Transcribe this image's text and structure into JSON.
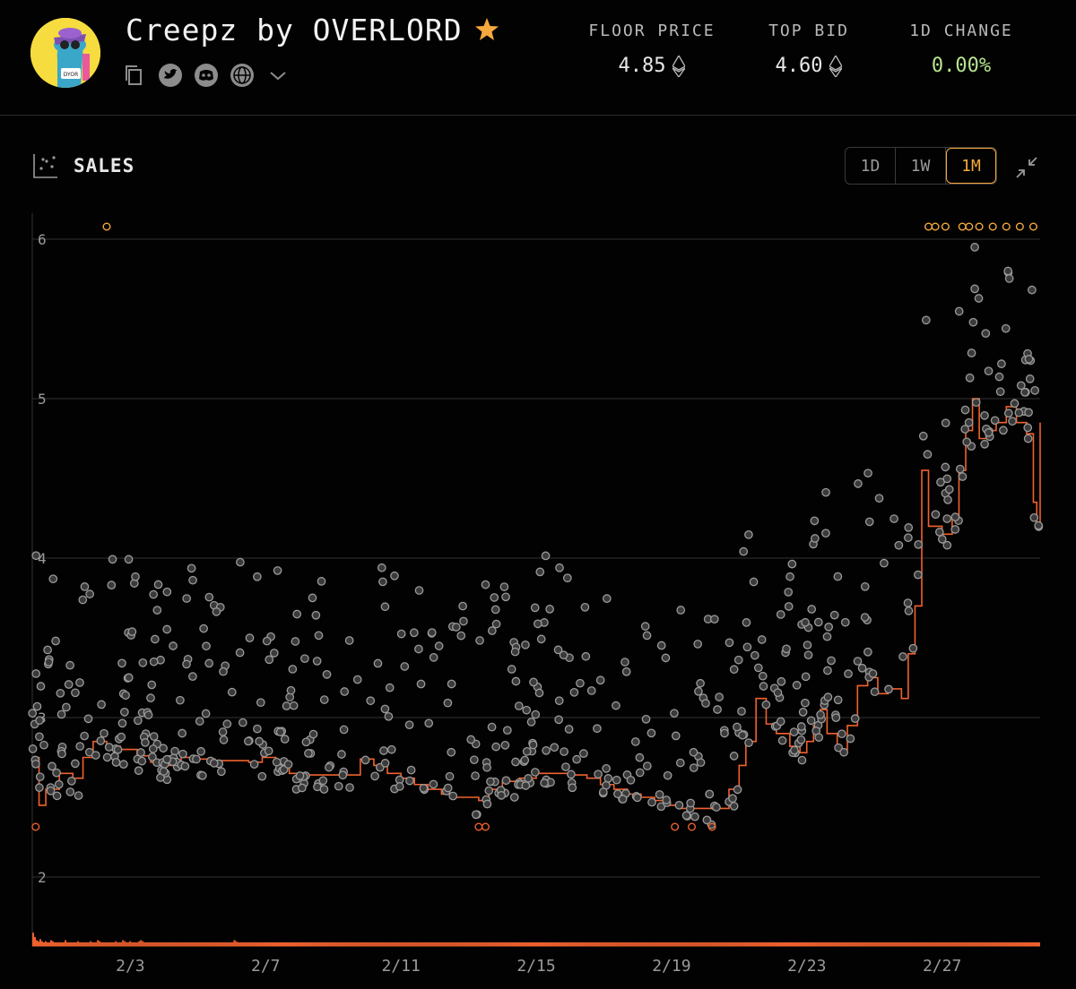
{
  "collection": {
    "name": "Creepz by OVERLORD",
    "avatar_text": "DYOR",
    "icons": [
      "copy-icon",
      "twitter-icon",
      "discord-icon",
      "globe-icon",
      "chevron-down-icon"
    ]
  },
  "stats": [
    {
      "label": "FLOOR PRICE",
      "value": "4.85",
      "unit_icon": "eth-icon"
    },
    {
      "label": "TOP BID",
      "value": "4.60",
      "unit_icon": "eth-icon"
    },
    {
      "label": "1D CHANGE",
      "value": "0.00%",
      "color": "#b7e58e"
    }
  ],
  "sales": {
    "label": "SALES",
    "ranges": [
      "1D",
      "1W",
      "1M"
    ],
    "active_range": "1M"
  },
  "colors": {
    "accent": "#f5a93e",
    "floor_line": "#f0622e",
    "sale_dot": "#9a9a9a",
    "background": "#020202"
  },
  "chart_data": {
    "type": "scatter",
    "title": "",
    "xlabel": "",
    "ylabel": "",
    "y_ticks": [
      2,
      3,
      4,
      5,
      6
    ],
    "ylim": [
      1.6,
      6.2
    ],
    "x_ticks": [
      "2/3",
      "2/7",
      "2/11",
      "2/15",
      "2/19",
      "2/23",
      "2/27"
    ],
    "x_tick_days": [
      3,
      7,
      11,
      15,
      19,
      23,
      27
    ],
    "xlim": [
      29.1,
      58.9
    ],
    "grid": true,
    "series": [
      {
        "type": "step_line",
        "points": [
          [
            29.1,
            2.75
          ],
          [
            29.3,
            2.45
          ],
          [
            29.5,
            2.55
          ],
          [
            29.9,
            2.65
          ],
          [
            30.3,
            2.62
          ],
          [
            30.6,
            2.75
          ],
          [
            30.9,
            2.85
          ],
          [
            31.3,
            2.82
          ],
          [
            31.7,
            2.8
          ],
          [
            32.2,
            2.76
          ],
          [
            32.6,
            2.72
          ],
          [
            33.0,
            2.7
          ],
          [
            33.5,
            2.75
          ],
          [
            34.0,
            2.74
          ],
          [
            34.5,
            2.73
          ],
          [
            35.0,
            2.73
          ],
          [
            35.5,
            2.72
          ],
          [
            35.9,
            2.75
          ],
          [
            36.3,
            2.7
          ],
          [
            36.7,
            2.65
          ],
          [
            37.2,
            2.64
          ],
          [
            37.7,
            2.64
          ],
          [
            38.3,
            2.64
          ],
          [
            38.8,
            2.74
          ],
          [
            39.2,
            2.7
          ],
          [
            39.6,
            2.65
          ],
          [
            40.0,
            2.62
          ],
          [
            40.4,
            2.58
          ],
          [
            40.8,
            2.55
          ],
          [
            41.2,
            2.52
          ],
          [
            41.6,
            2.5
          ],
          [
            42.0,
            2.5
          ],
          [
            42.3,
            2.48
          ],
          [
            42.6,
            2.55
          ],
          [
            43.0,
            2.6
          ],
          [
            43.5,
            2.62
          ],
          [
            44.0,
            2.65
          ],
          [
            44.5,
            2.65
          ],
          [
            45.0,
            2.64
          ],
          [
            45.5,
            2.62
          ],
          [
            45.9,
            2.58
          ],
          [
            46.3,
            2.55
          ],
          [
            46.7,
            2.52
          ],
          [
            47.1,
            2.5
          ],
          [
            47.5,
            2.48
          ],
          [
            47.9,
            2.45
          ],
          [
            48.3,
            2.43
          ],
          [
            48.8,
            2.43
          ],
          [
            49.3,
            2.43
          ],
          [
            49.7,
            2.55
          ],
          [
            50.0,
            2.7
          ],
          [
            50.2,
            2.85
          ],
          [
            50.5,
            3.12
          ],
          [
            50.8,
            2.96
          ],
          [
            51.1,
            2.9
          ],
          [
            51.5,
            2.82
          ],
          [
            51.8,
            2.78
          ],
          [
            52.0,
            2.85
          ],
          [
            52.2,
            2.95
          ],
          [
            52.4,
            3.05
          ],
          [
            52.6,
            2.9
          ],
          [
            52.9,
            2.8
          ],
          [
            53.2,
            2.95
          ],
          [
            53.5,
            3.2
          ],
          [
            53.8,
            3.25
          ],
          [
            54.1,
            3.15
          ],
          [
            54.4,
            3.18
          ],
          [
            54.8,
            3.12
          ],
          [
            55.0,
            3.4
          ],
          [
            55.2,
            3.7
          ],
          [
            55.4,
            4.55
          ],
          [
            55.6,
            4.2
          ],
          [
            56.0,
            4.15
          ],
          [
            56.3,
            4.25
          ],
          [
            56.5,
            4.55
          ],
          [
            56.7,
            4.8
          ],
          [
            56.9,
            5.0
          ],
          [
            57.1,
            4.75
          ],
          [
            57.3,
            4.8
          ],
          [
            57.6,
            4.85
          ],
          [
            57.9,
            4.95
          ],
          [
            58.2,
            4.85
          ],
          [
            58.5,
            4.78
          ],
          [
            58.7,
            4.35
          ],
          [
            58.8,
            4.2
          ],
          [
            58.9,
            4.85
          ]
        ]
      },
      {
        "type": "volume_bars",
        "values": [
          1.2,
          0.8,
          0.5,
          0.4,
          0.6,
          0.4,
          0.3,
          0.4,
          0.3,
          0.3,
          0.5,
          0.4,
          0.3,
          0.3,
          0.3,
          0.3,
          0.3,
          0.3,
          0.5,
          0.3,
          0.3,
          0.3,
          0.3,
          0.3,
          0.3,
          0.4,
          0.3,
          0.3,
          0.3,
          0.3,
          0.3,
          0.3,
          0.4,
          0.3,
          0.3,
          0.3,
          0.5,
          0.4,
          0.3,
          0.3,
          0.3,
          0.3,
          0.3,
          0.3,
          0.3,
          0.3,
          0.4,
          0.3,
          0.3,
          0.3,
          0.5,
          0.4,
          0.3,
          0.3,
          0.4,
          0.3,
          0.3,
          0.3,
          0.3,
          0.4,
          0.5,
          0.4,
          0.3,
          0.3,
          0.3,
          0.3,
          0.3,
          0.3,
          0.3,
          0.3,
          0.3,
          0.3,
          0.3,
          0.3,
          0.3,
          0.3,
          0.3,
          0.3,
          0.3,
          0.3,
          0.3,
          0.3,
          0.3,
          0.3,
          0.3,
          0.3,
          0.3,
          0.3,
          0.3,
          0.3,
          0.3,
          0.3,
          0.3,
          0.3,
          0.3,
          0.3,
          0.3,
          0.3,
          0.3,
          0.3,
          0.3,
          0.3,
          0.3,
          0.3,
          0.3,
          0.3,
          0.3,
          0.3,
          0.3,
          0.3,
          0.3,
          0.3,
          0.5,
          0.4,
          0.3,
          0.3,
          0.3,
          0.3,
          0.3,
          0.3,
          0.3,
          0.3,
          0.3,
          0.3,
          0.3,
          0.3,
          0.3,
          0.3,
          0.3,
          0.3,
          0.3,
          0.3,
          0.3,
          0.3,
          0.3,
          0.3,
          0.3,
          0.3,
          0.3,
          0.3,
          0.3,
          0.3,
          0.3,
          0.3,
          0.3,
          0.3,
          0.3,
          0.3,
          0.3,
          0.3,
          0.3,
          0.3,
          0.3,
          0.3,
          0.3,
          0.3,
          0.3,
          0.3,
          0.3,
          0.3,
          0.3,
          0.3,
          0.3,
          0.3,
          0.3,
          0.3,
          0.3,
          0.3,
          0.3,
          0.3,
          0.3,
          0.3,
          0.3,
          0.3,
          0.3,
          0.3,
          0.3,
          0.3,
          0.3,
          0.3,
          0.3,
          0.3,
          0.3,
          0.3,
          0.3,
          0.3,
          0.3,
          0.3,
          0.3,
          0.3,
          0.3,
          0.3,
          0.3,
          0.3,
          0.3,
          0.3,
          0.3,
          0.3,
          0.3,
          0.3,
          0.3,
          0.3,
          0.3,
          0.3,
          0.3,
          0.3,
          0.3,
          0.3,
          0.3,
          0.3,
          0.3,
          0.3,
          0.3,
          0.3,
          0.3,
          0.3,
          0.3,
          0.3,
          0.3,
          0.3,
          0.3,
          0.3,
          0.3,
          0.3,
          0.3,
          0.3,
          0.3,
          0.3,
          0.3,
          0.3,
          0.3,
          0.3,
          0.3,
          0.3,
          0.3,
          0.3,
          0.3,
          0.3,
          0.3,
          0.3,
          0.3,
          0.3,
          0.3,
          0.3,
          0.3,
          0.3,
          0.3,
          0.3,
          0.3,
          0.3,
          0.3,
          0.3,
          0.3,
          0.3,
          0.3,
          0.3,
          0.3,
          0.3,
          0.3,
          0.3,
          0.3,
          0.3,
          0.3,
          0.3,
          0.3,
          0.3,
          0.3,
          0.3,
          0.3,
          0.3,
          0.3,
          0.3,
          0.3,
          0.3,
          0.3,
          0.3,
          0.3,
          0.3,
          0.3,
          0.3,
          0.3,
          0.3,
          0.3,
          0.3,
          0.3,
          0.3,
          0.3,
          0.3,
          0.3,
          0.3,
          0.3,
          0.3,
          0.3,
          0.3,
          0.3,
          0.3,
          0.3,
          0.3,
          0.3,
          0.3,
          0.3,
          0.3,
          0.3,
          0.3,
          0.3,
          0.3,
          0.3,
          0.3,
          0.3,
          0.3,
          0.3,
          0.3,
          0.3,
          0.3,
          0.3,
          0.3,
          0.3,
          0.3,
          0.3,
          0.3,
          0.3,
          0.3,
          0.3,
          0.3,
          0.3,
          0.3,
          0.3,
          0.3,
          0.3,
          0.3,
          0.3,
          0.3,
          0.3,
          0.3,
          0.3,
          0.3,
          0.3,
          0.3,
          0.3,
          0.3,
          0.3,
          0.3,
          0.3,
          0.3,
          0.3,
          0.3,
          0.3,
          0.3,
          0.3,
          0.3,
          0.3,
          0.3,
          0.3,
          0.3,
          0.3,
          0.3,
          0.3,
          0.3,
          0.3,
          0.3,
          0.3,
          0.3,
          0.3,
          0.3,
          0.3,
          0.3,
          0.3,
          0.3,
          0.3,
          0.3,
          0.3,
          0.3,
          0.3,
          0.3,
          0.3,
          0.3,
          0.3,
          0.3,
          0.3,
          0.3,
          0.3,
          0.3,
          0.3,
          0.3,
          0.3,
          0.3,
          0.3,
          0.3,
          0.3,
          0.3,
          0.3,
          0.3,
          0.3,
          0.3,
          0.3,
          0.3,
          0.3,
          0.3,
          0.3,
          0.3,
          0.3,
          0.3,
          0.3,
          0.3,
          0.3,
          0.3,
          0.3,
          0.3,
          0.3,
          0.3,
          0.3,
          0.3,
          0.3,
          0.3,
          0.3,
          0.3,
          0.3,
          0.3,
          0.3,
          0.3,
          0.3,
          0.3,
          0.3,
          0.3,
          0.3,
          0.3,
          0.3,
          0.3,
          0.3,
          0.3,
          0.3,
          0.3,
          0.3,
          0.3,
          0.3,
          0.3,
          0.3,
          0.3,
          0.3,
          0.3,
          0.3,
          0.3,
          0.3,
          0.3,
          0.3,
          0.3,
          0.3,
          0.3,
          0.3,
          0.3,
          0.3,
          0.3,
          0.3,
          0.3,
          0.3,
          0.3,
          0.3,
          0.3,
          0.3,
          0.3,
          0.3,
          0.3,
          0.3,
          0.3,
          0.3,
          0.3,
          0.3,
          0.3,
          0.3,
          0.3,
          0.3,
          0.3,
          0.3,
          0.3,
          0.3,
          0.3,
          0.3,
          0.3,
          0.3,
          0.3,
          0.3,
          0.3,
          0.3,
          0.3,
          0.3,
          0.3,
          0.3,
          0.3,
          0.3,
          0.3,
          0.3,
          0.3,
          0.3,
          0.3,
          0.3,
          0.3,
          0.3,
          0.3,
          0.3,
          0.3,
          0.3,
          0.3,
          0.3,
          0.3,
          0.3,
          0.3,
          0.3,
          0.3,
          0.3,
          0.3,
          0.3,
          0.3,
          0.3,
          0.3,
          0.3,
          0.3,
          0.3,
          0.3,
          0.3,
          0.3,
          0.3,
          0.3,
          0.3,
          0.3,
          0.3,
          0.3,
          0.3,
          0.3,
          0.3,
          0.3,
          0.3,
          0.3,
          0.3,
          0.3,
          0.3,
          0.3,
          0.3,
          0.3,
          0.3,
          0.3,
          0.3,
          0.3,
          0.3,
          0.3,
          0.3,
          0.3,
          0.3,
          0.3,
          0.3,
          0.3,
          0.3,
          0.3,
          0.3,
          0.3,
          0.3,
          0.3,
          0.3,
          0.3,
          0.3,
          0.3,
          0.3
        ]
      }
    ]
  }
}
